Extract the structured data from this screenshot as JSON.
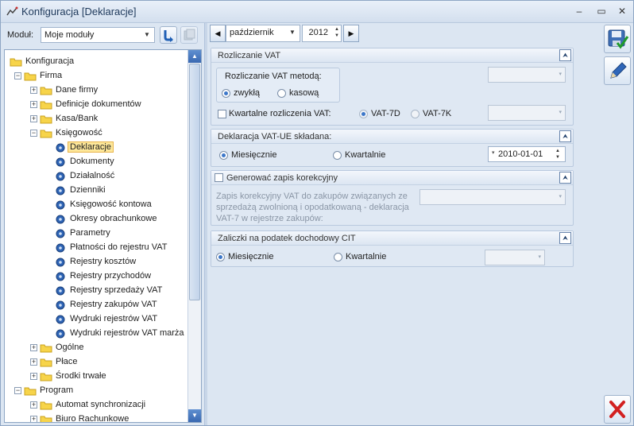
{
  "window": {
    "title": "Konfiguracja [Deklaracje]",
    "controls": {
      "minimize": "–",
      "maximize": "▭",
      "close": "✕"
    }
  },
  "left": {
    "modul_label": "Moduł:",
    "modul_value": "Moje moduły",
    "tree": [
      {
        "label": "Konfiguracja",
        "level": 0,
        "exp": "",
        "icon": "folder",
        "selected": false
      },
      {
        "label": "Firma",
        "level": 1,
        "exp": "−",
        "icon": "folder",
        "selected": false
      },
      {
        "label": "Dane firmy",
        "level": 2,
        "exp": "+",
        "icon": "folder",
        "selected": false
      },
      {
        "label": "Definicje dokumentów",
        "level": 2,
        "exp": "+",
        "icon": "folder",
        "selected": false
      },
      {
        "label": "Kasa/Bank",
        "level": 2,
        "exp": "+",
        "icon": "folder",
        "selected": false
      },
      {
        "label": "Księgowość",
        "level": 2,
        "exp": "−",
        "icon": "folder",
        "selected": false
      },
      {
        "label": "Deklaracje",
        "level": 3,
        "exp": "",
        "icon": "gear",
        "selected": true
      },
      {
        "label": "Dokumenty",
        "level": 3,
        "exp": "",
        "icon": "gear",
        "selected": false
      },
      {
        "label": "Działalność",
        "level": 3,
        "exp": "",
        "icon": "gear",
        "selected": false
      },
      {
        "label": "Dzienniki",
        "level": 3,
        "exp": "",
        "icon": "gear",
        "selected": false
      },
      {
        "label": "Księgowość kontowa",
        "level": 3,
        "exp": "",
        "icon": "gear",
        "selected": false
      },
      {
        "label": "Okresy obrachunkowe",
        "level": 3,
        "exp": "",
        "icon": "gear",
        "selected": false
      },
      {
        "label": "Parametry",
        "level": 3,
        "exp": "",
        "icon": "gear",
        "selected": false
      },
      {
        "label": "Płatności do rejestru VAT",
        "level": 3,
        "exp": "",
        "icon": "gear",
        "selected": false
      },
      {
        "label": "Rejestry kosztów",
        "level": 3,
        "exp": "",
        "icon": "gear",
        "selected": false
      },
      {
        "label": "Rejestry przychodów",
        "level": 3,
        "exp": "",
        "icon": "gear",
        "selected": false
      },
      {
        "label": "Rejestry sprzedaży VAT",
        "level": 3,
        "exp": "",
        "icon": "gear",
        "selected": false
      },
      {
        "label": "Rejestry zakupów VAT",
        "level": 3,
        "exp": "",
        "icon": "gear",
        "selected": false
      },
      {
        "label": "Wydruki rejestrów VAT",
        "level": 3,
        "exp": "",
        "icon": "gear",
        "selected": false
      },
      {
        "label": "Wydruki rejestrów VAT marża",
        "level": 3,
        "exp": "",
        "icon": "gear",
        "selected": false
      },
      {
        "label": "Ogólne",
        "level": 2,
        "exp": "+",
        "icon": "folder",
        "selected": false
      },
      {
        "label": "Płace",
        "level": 2,
        "exp": "+",
        "icon": "folder",
        "selected": false
      },
      {
        "label": "Środki trwałe",
        "level": 2,
        "exp": "+",
        "icon": "folder",
        "selected": false
      },
      {
        "label": "Program",
        "level": 1,
        "exp": "−",
        "icon": "folder",
        "selected": false
      },
      {
        "label": "Automat synchronizacji",
        "level": 2,
        "exp": "+",
        "icon": "folder",
        "selected": false
      },
      {
        "label": "Biuro Rachunkowe",
        "level": 2,
        "exp": "+",
        "icon": "folder",
        "selected": false
      }
    ]
  },
  "period": {
    "month": "październik",
    "year": "2012"
  },
  "sections": {
    "vat": {
      "title": "Rozliczanie VAT",
      "group_title": "Rozliczanie VAT metodą:",
      "opt1": "zwykłą",
      "opt2": "kasową",
      "quarterly_label": "Kwartalne rozliczenia VAT:",
      "vat7d": "VAT-7D",
      "vat7k": "VAT-7K"
    },
    "vatue": {
      "title": "Deklaracja VAT-UE składana:",
      "monthly": "Miesięcznie",
      "quarterly": "Kwartalnie",
      "date": "2010-01-01"
    },
    "corr": {
      "title": "Generować zapis korekcyjny",
      "desc": "Zapis korekcyjny VAT do zakupów związanych ze sprzedażą zwolnioną i opodatkowaną - deklaracja VAT-7 w rejestrze zakupów:"
    },
    "cit": {
      "title": "Zaliczki na podatek dochodowy CIT",
      "monthly": "Miesięcznie",
      "quarterly": "Kwartalnie"
    }
  },
  "colors": {
    "accent": "#3c77c9",
    "selection": "#fde79a",
    "background": "#dce6f2"
  }
}
